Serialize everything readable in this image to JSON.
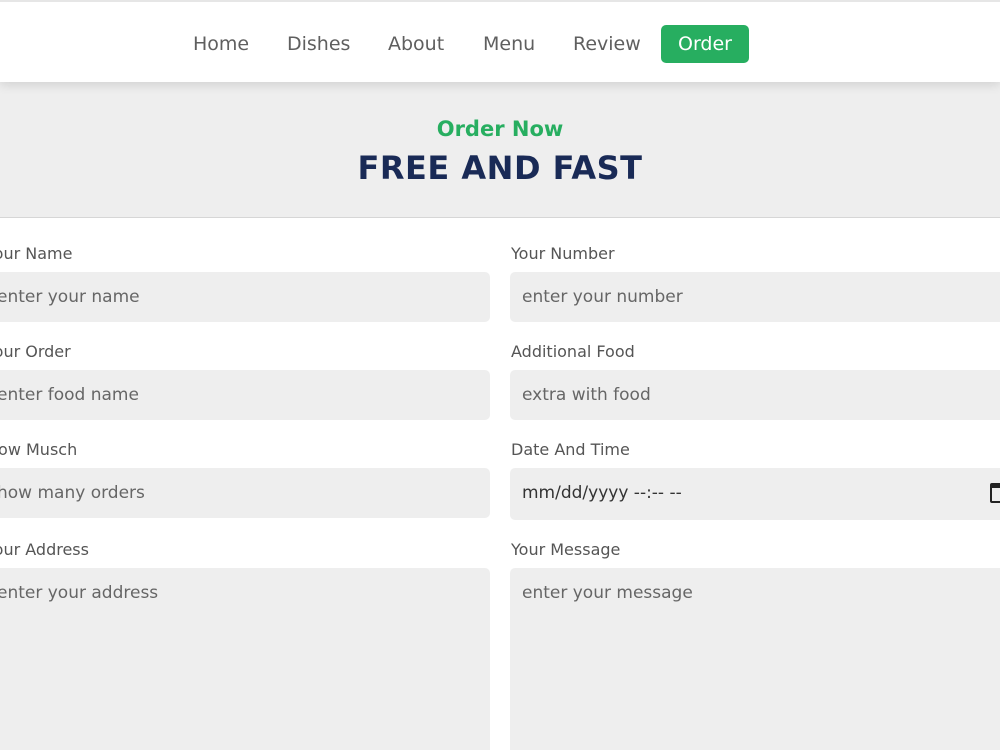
{
  "nav": {
    "items": [
      {
        "label": "Home"
      },
      {
        "label": "Dishes"
      },
      {
        "label": "About"
      },
      {
        "label": "Menu"
      },
      {
        "label": "Review"
      }
    ],
    "cta": "Order"
  },
  "hero": {
    "subtitle": "Order Now",
    "title": "FREE AND FAST"
  },
  "form": {
    "name": {
      "label": "Your Name",
      "placeholder": "enter your name"
    },
    "number": {
      "label": "Your Number",
      "placeholder": "enter your number"
    },
    "order": {
      "label": "Your Order",
      "placeholder": "enter food name"
    },
    "additional": {
      "label": "Additional Food",
      "placeholder": "extra with food"
    },
    "quantity": {
      "label": "How Musch",
      "placeholder": "how many orders"
    },
    "datetime": {
      "label": "Date And Time",
      "value": "mm/dd/yyyy --:-- --"
    },
    "address": {
      "label": "Your Address",
      "placeholder": "enter your address"
    },
    "message": {
      "label": "Your Message",
      "placeholder": "enter your message"
    }
  },
  "colors": {
    "accent": "#27ae60",
    "title": "#192a56",
    "field_bg": "#eeeeee"
  }
}
